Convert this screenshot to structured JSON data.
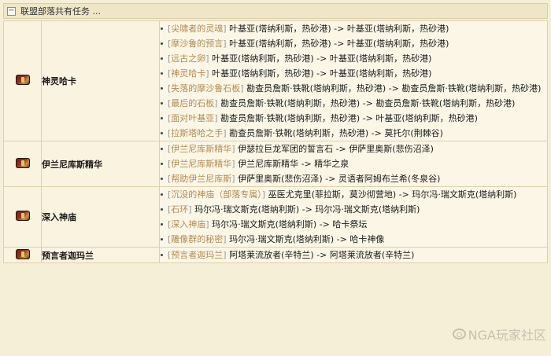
{
  "header": {
    "toggle": "−",
    "title": "联盟部落共有任务 ..."
  },
  "chains": [
    {
      "name": "神灵哈卡",
      "steps": [
        {
          "quest": "尖啸者的灵魂",
          "route": "叶基亚(塔纳利斯，热砂港) -> 叶基亚(塔纳利斯，热砂港)"
        },
        {
          "quest": "摩沙鲁的预言",
          "route": "叶基亚(塔纳利斯，热砂港) -> 叶基亚(塔纳利斯，热砂港)"
        },
        {
          "quest": "远古之卵",
          "route": "叶基亚(塔纳利斯，热砂港) -> 叶基亚(塔纳利斯，热砂港)"
        },
        {
          "quest": "神灵哈卡",
          "route": "叶基亚(塔纳利斯，热砂港) -> 叶基亚(塔纳利斯，热砂港)"
        },
        {
          "quest": "失落的摩沙鲁石板",
          "route": "勘查员詹斯·铁靴(塔纳利斯，热砂港) -> 勘查员詹斯·铁靴(塔纳利斯，热砂港)"
        },
        {
          "quest": "最后的石板",
          "route": "勘查员詹斯·铁靴(塔纳利斯，热砂港) -> 勘查员詹斯·铁靴(塔纳利斯，热砂港)"
        },
        {
          "quest": "面对叶基亚",
          "route": "勘查员詹斯·铁靴(塔纳利斯，热砂港) -> 叶基亚(塔纳利斯，热砂港)"
        },
        {
          "quest": "拉斯塔哈之手",
          "route": "勘查员詹斯·铁靴(塔纳利斯，热砂港) -> 莫托尔(荆棘谷)"
        }
      ]
    },
    {
      "name": "伊兰尼库斯精华",
      "steps": [
        {
          "quest": "伊兰尼库斯精华",
          "route": "伊瑟拉巨龙军团的誓言石 -> 伊萨里奥斯(悲伤沼泽)"
        },
        {
          "quest": "伊兰尼库斯精华",
          "route": "伊兰尼库斯精华 -> 精华之泉"
        },
        {
          "quest": "帮助伊兰尼库斯",
          "route": "伊萨里奥斯(悲伤沼泽) -> 灵语者阿姆布兰希(冬泉谷)"
        }
      ]
    },
    {
      "name": "深入神庙",
      "steps": [
        {
          "quest": "沉没的神庙（部落专属）",
          "route": "巫医尤克里(菲拉斯，莫沙彻营地) -> 玛尔冯·瑞文斯克(塔纳利斯)"
        },
        {
          "quest": "石环",
          "route": "玛尔冯·瑞文斯克(塔纳利斯) -> 玛尔冯·瑞文斯克(塔纳利斯)"
        },
        {
          "quest": "深入神庙",
          "route": "玛尔冯·瑞文斯克(塔纳利斯) -> 哈卡祭坛"
        },
        {
          "quest": "雕像群的秘密",
          "route": "玛尔冯·瑞文斯克(塔纳利斯) -> 哈卡神像"
        }
      ]
    },
    {
      "name": "预言者迦玛兰",
      "steps": [
        {
          "quest": "预言者迦玛兰",
          "route": "阿塔莱流放者(辛特兰) -> 阿塔莱流放者(辛特兰)"
        }
      ]
    }
  ],
  "watermark": "NGA玩家社区",
  "colors": {
    "background": "#f6efd8",
    "quest_name": "#b38a55",
    "bracket": "#999999",
    "border": "#ddd0ac"
  }
}
